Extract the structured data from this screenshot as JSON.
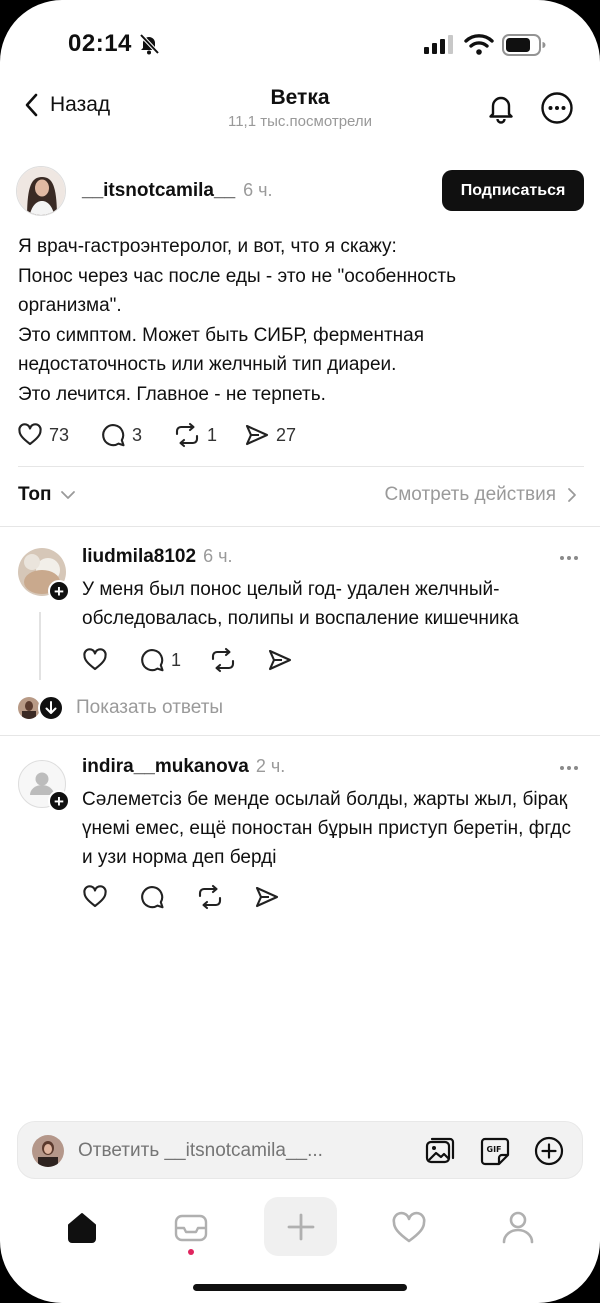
{
  "status_bar": {
    "time": "02:14"
  },
  "header": {
    "back_label": "Назад",
    "title": "Ветка",
    "subtitle": "11,1 тыс.посмотрели"
  },
  "post": {
    "username": "__itsnotcamila__",
    "time": "6 ч.",
    "follow_label": "Подписаться",
    "lines": [
      "Я врач-гастроэнтеролог, и вот, что я скажу:",
      "Понос через час после еды - это не \"особенность организма\".",
      "Это симптом. Может быть СИБР, ферментная недостаточность или желчный тип диареи.",
      "Это лечится. Главное - не терпеть."
    ],
    "likes": "73",
    "comments": "3",
    "reposts": "1",
    "shares": "27"
  },
  "sort": {
    "label": "Топ",
    "activity_label": "Смотреть действия"
  },
  "replies": [
    {
      "username": "liudmila8102",
      "time": "6 ч.",
      "text": "У меня был понос целый год- удален желчный- обследовалась, полипы и воспаление кишечника",
      "comments": "1",
      "show_replies_label": "Показать ответы"
    },
    {
      "username": "indira__mukanova",
      "time": "2 ч.",
      "text": "Сәлеметсіз бе менде осылай болды, жарты жыл, бірақ үнемі емес, ещё поностан бұрын приступ беретін, фгдс и узи норма деп берді"
    }
  ],
  "composer": {
    "placeholder": "Ответить __itsnotcamila__..."
  },
  "colors": {
    "accent": "#101010",
    "muted": "#9a9a9a",
    "notification_dot": "#e0245e"
  }
}
